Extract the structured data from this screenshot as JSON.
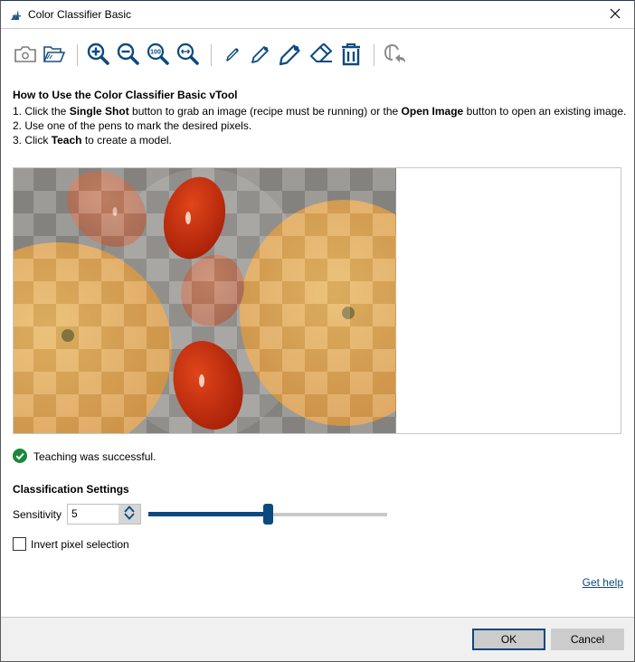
{
  "window": {
    "title": "Color Classifier Basic",
    "app_icon": "vtool-icon",
    "close_icon": "close-icon"
  },
  "toolbar": {
    "groups": [
      [
        {
          "name": "single-shot",
          "icon": "camera-icon",
          "tooltip": "Single Shot"
        },
        {
          "name": "open-image",
          "icon": "folder-open-icon",
          "tooltip": "Open Image"
        }
      ],
      [
        {
          "name": "zoom-in",
          "icon": "zoom-in-icon"
        },
        {
          "name": "zoom-out",
          "icon": "zoom-out-icon"
        },
        {
          "name": "zoom-100",
          "icon": "zoom-100-icon",
          "text": "100"
        },
        {
          "name": "zoom-fit",
          "icon": "zoom-fit-width-icon"
        }
      ],
      [
        {
          "name": "pen-small",
          "icon": "pen-small-icon"
        },
        {
          "name": "pen-medium",
          "icon": "pen-medium-icon"
        },
        {
          "name": "pen-large",
          "icon": "pen-large-icon"
        },
        {
          "name": "eraser",
          "icon": "eraser-icon"
        },
        {
          "name": "delete",
          "icon": "trash-icon"
        }
      ],
      [
        {
          "name": "teach",
          "icon": "teach-icon",
          "disabled": true
        }
      ]
    ]
  },
  "instructions": {
    "heading": "How to Use the Color Classifier Basic vTool",
    "steps": [
      {
        "prefix": "1. Click the ",
        "bold1": "Single Shot",
        "mid": " button to grab an image (recipe must be running) or the ",
        "bold2": "Open Image",
        "suffix": " button to open an existing image."
      },
      {
        "text": "2. Use one of the pens to mark the desired pixels."
      },
      {
        "prefix": "3. Click ",
        "bold1": "Teach",
        "suffix": " to create a model."
      }
    ]
  },
  "image_view": {
    "description": "Tomatoes and oranges with checkerboard classification overlay",
    "overlay": "checkerboard"
  },
  "status": {
    "icon": "check-circle-icon",
    "text": "Teaching was successful.",
    "color": "#1a8a3a"
  },
  "classification": {
    "title": "Classification Settings",
    "sensitivity_label": "Sensitivity",
    "sensitivity_value": "5",
    "sensitivity_min": 0,
    "sensitivity_max": 10,
    "invert_label": "Invert pixel selection",
    "invert_checked": false
  },
  "help": {
    "label": "Get help"
  },
  "footer": {
    "ok_label": "OK",
    "cancel_label": "Cancel"
  },
  "colors": {
    "accent": "#0b4a80",
    "success": "#1a8a3a",
    "disabled": "#8a8a8a"
  }
}
